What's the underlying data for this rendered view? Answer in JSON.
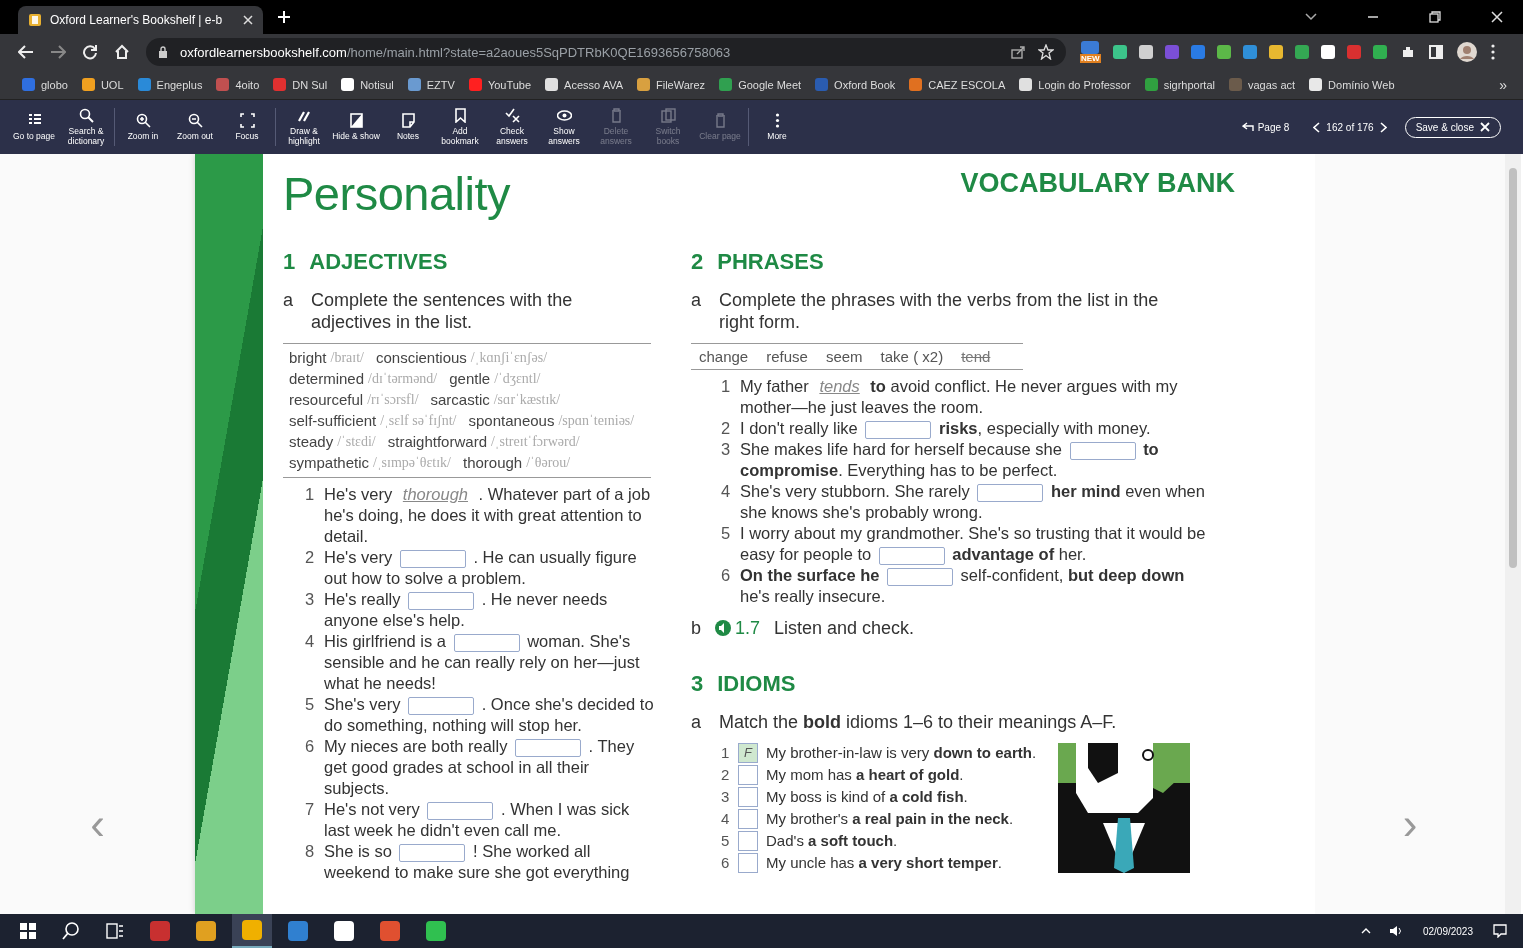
{
  "browser": {
    "tabs": [
      {
        "title": "Oxford Learner's Bookshelf | e-b",
        "selected": true
      }
    ],
    "url": {
      "host": "oxfordlearnersbookshelf.com",
      "path": "/home/main.html?state=a2aoues5SqPDTRbK0QE1693656758063"
    },
    "extensions": [
      {
        "color": "#3b7bd4",
        "badge": "NEW"
      },
      {
        "color": "#3cc48a"
      },
      {
        "color": "#d0d0d0"
      },
      {
        "color": "#7b4fd6"
      },
      {
        "color": "#2a7be4"
      },
      {
        "color": "#5cb848"
      },
      {
        "color": "#2f8fd8"
      },
      {
        "color": "#e8b830"
      },
      {
        "color": "#34a853"
      },
      {
        "color": "#ffffff"
      },
      {
        "color": "#d93030"
      },
      {
        "color": "#30b050"
      }
    ],
    "bookmarks": [
      {
        "label": "globo",
        "color": "#2f6fe0"
      },
      {
        "label": "UOL",
        "color": "#f0a020"
      },
      {
        "label": "Engeplus",
        "color": "#2a8ad8"
      },
      {
        "label": "4oito",
        "color": "#c05050"
      },
      {
        "label": "DN Sul",
        "color": "#e03030"
      },
      {
        "label": "Notisul",
        "color": "#ffffff"
      },
      {
        "label": "EZTV",
        "color": "#6a9ad0"
      },
      {
        "label": "YouTube",
        "color": "#ff2020"
      },
      {
        "label": "Acesso AVA",
        "color": "#e0e0e0"
      },
      {
        "label": "FileWarez",
        "color": "#d8a040"
      },
      {
        "label": "Google Meet",
        "color": "#30a050"
      },
      {
        "label": "Oxford Book",
        "color": "#2a5cb0"
      },
      {
        "label": "CAEZ ESCOLA",
        "color": "#e07020"
      },
      {
        "label": "Login do Professor",
        "color": "#e0e0e0"
      },
      {
        "label": "sigrhportal",
        "color": "#30a040"
      },
      {
        "label": "vagas act",
        "color": "#6b5b4b"
      },
      {
        "label": "Domínio Web",
        "color": "#e8e8e8"
      }
    ],
    "bookmarks_more": "»"
  },
  "toolbar": {
    "tools": [
      {
        "kind": "button",
        "label": "Go to page",
        "disabled": false
      },
      {
        "kind": "button",
        "label": "Search & dictionary",
        "disabled": false
      },
      {
        "kind": "separator"
      },
      {
        "kind": "button",
        "label": "Zoom in",
        "disabled": false
      },
      {
        "kind": "button",
        "label": "Zoom out",
        "disabled": false
      },
      {
        "kind": "button",
        "label": "Focus",
        "disabled": false
      },
      {
        "kind": "separator"
      },
      {
        "kind": "button",
        "label": "Draw & highlight",
        "disabled": false
      },
      {
        "kind": "button",
        "label": "Hide & show",
        "disabled": false
      },
      {
        "kind": "button",
        "label": "Notes",
        "disabled": false
      },
      {
        "kind": "button",
        "label": "Add bookmark",
        "disabled": false
      },
      {
        "kind": "button",
        "label": "Check answers",
        "disabled": false
      },
      {
        "kind": "button",
        "label": "Show answers",
        "disabled": false
      },
      {
        "kind": "button",
        "label": "Delete answers",
        "disabled": true
      },
      {
        "kind": "button",
        "label": "Switch books",
        "disabled": true
      },
      {
        "kind": "button",
        "label": "Clear page",
        "disabled": true
      },
      {
        "kind": "separator"
      },
      {
        "kind": "button",
        "label": "More",
        "disabled": false
      }
    ],
    "page_link": "Page 8",
    "page_count": "162 of 176",
    "save_close": "Save & close"
  },
  "page": {
    "prev_arrow": "‹",
    "next_arrow": "›",
    "title": "Personality",
    "banner": "VOCABULARY BANK",
    "adjectives": {
      "number": "1",
      "heading": "ADJECTIVES",
      "letter": "a",
      "instruction": "Complete the sentences with the adjectives in the list.",
      "words": [
        {
          "word": "bright",
          "phonetic": "/braɪt/"
        },
        {
          "word": "conscientious",
          "phonetic": "/ˌkɑnʃiˈɛnʃəs/"
        },
        {
          "word": "determined",
          "phonetic": "/dɪˈtərmənd/"
        },
        {
          "word": "gentle",
          "phonetic": "/ˈdʒɛntl/"
        },
        {
          "word": "resourceful",
          "phonetic": "/rɪˈsɔrsfl/"
        },
        {
          "word": "sarcastic",
          "phonetic": "/sɑrˈkæstɪk/"
        },
        {
          "word": "self-sufficient",
          "phonetic": "/ˌsɛlf səˈfɪʃnt/"
        },
        {
          "word": "spontaneous",
          "phonetic": "/spɑnˈteɪniəs/"
        },
        {
          "word": "steady",
          "phonetic": "/ˈstɛdi/"
        },
        {
          "word": "straightforward",
          "phonetic": "/ˌstreɪtˈfɔrwərd/"
        },
        {
          "word": "sympathetic",
          "phonetic": "/ˌsɪmpəˈθɛtɪk/"
        },
        {
          "word": "thorough",
          "phonetic": "/ˈθərou/"
        }
      ],
      "items": [
        {
          "number": "1",
          "before": "He's very",
          "gap": {
            "kind": "example",
            "value": "thorough"
          },
          "after": ". Whatever part of a job he's doing, he does it with great attention to detail."
        },
        {
          "number": "2",
          "before": "He's very",
          "gap": {
            "kind": "input"
          },
          "after": ". He can usually figure out how to solve a problem."
        },
        {
          "number": "3",
          "before": "He's really",
          "gap": {
            "kind": "input"
          },
          "after": ". He never needs anyone else's help."
        },
        {
          "number": "4",
          "before": "His girlfriend is a",
          "gap": {
            "kind": "input"
          },
          "after": "woman. She's sensible and he can really rely on her—just what he needs!"
        },
        {
          "number": "5",
          "before": "She's very",
          "gap": {
            "kind": "input"
          },
          "after": ". Once she's decided to do something, nothing will stop her."
        },
        {
          "number": "6",
          "before": "My nieces are both really",
          "gap": {
            "kind": "input"
          },
          "after": ". They get good grades at school in all their subjects."
        },
        {
          "number": "7",
          "before": "He's not very",
          "gap": {
            "kind": "input"
          },
          "after": ". When I was sick last week he didn't even call me."
        },
        {
          "number": "8",
          "before": "She is so",
          "gap": {
            "kind": "input"
          },
          "after": "! She worked all weekend to make sure she got everything"
        }
      ]
    },
    "phrases": {
      "number": "2",
      "heading": "PHRASES",
      "letter": "a",
      "instruction": "Complete the phrases with the verbs from the list in the right form.",
      "words": [
        {
          "word": "change",
          "crossed": false
        },
        {
          "word": "refuse",
          "crossed": false
        },
        {
          "word": "seem",
          "crossed": false
        },
        {
          "word": "take ( x2)",
          "crossed": false
        },
        {
          "word": "tend",
          "crossed": true
        }
      ],
      "items": [
        {
          "number": "1",
          "before": "My father",
          "gap": {
            "kind": "example",
            "value": "tends"
          },
          "after": "**to** avoid conflict. He never argues with my mother—he just leaves the room."
        },
        {
          "number": "2",
          "before": "I don't really like",
          "gap": {
            "kind": "input"
          },
          "after": "**risks**, especially with money."
        },
        {
          "number": "3",
          "before": "She makes life hard for herself because she",
          "gap": {
            "kind": "input"
          },
          "after": "**to compromise**. Everything has to be perfect."
        },
        {
          "number": "4",
          "before": "She's very stubborn. She rarely",
          "gap": {
            "kind": "input"
          },
          "after": "**her mind** even when she knows she's probably wrong."
        },
        {
          "number": "5",
          "before": "I worry about my grandmother. She's so trusting that it would be easy for people to",
          "gap": {
            "kind": "input"
          },
          "after": "**advantage of** her."
        },
        {
          "number": "6",
          "before": "**On the surface he**",
          "gap": {
            "kind": "input"
          },
          "after": "self-confident, **but deep down** he's really insecure."
        }
      ],
      "listen": {
        "letter": "b",
        "track": "1.7",
        "text": "Listen and check."
      }
    },
    "idioms": {
      "number": "3",
      "heading": "IDIOMS",
      "letter": "a",
      "instruction": "Match the **bold** idioms 1–6 to their meanings A–F.",
      "items": [
        {
          "number": "1",
          "answer": {
            "kind": "example",
            "value": "F"
          },
          "text": "My brother-in-law is very **down to earth**."
        },
        {
          "number": "2",
          "answer": {
            "kind": "input"
          },
          "text": "My mom has **a heart of gold**."
        },
        {
          "number": "3",
          "answer": {
            "kind": "input"
          },
          "text": "My boss is kind of **a cold fish**."
        },
        {
          "number": "4",
          "answer": {
            "kind": "input"
          },
          "text": "My brother's **a real pain in the neck**."
        },
        {
          "number": "5",
          "answer": {
            "kind": "input"
          },
          "text": "Dad's **a soft touch**."
        },
        {
          "number": "6",
          "answer": {
            "kind": "input"
          },
          "text": "My uncle has **a very short temper**."
        }
      ]
    }
  },
  "taskbar": {
    "apps": [
      {
        "color": "#c83030",
        "selected": false
      },
      {
        "color": "#e0a020",
        "selected": false
      },
      {
        "color": "#f0b000",
        "selected": true
      },
      {
        "color": "#3080d0",
        "selected": false
      },
      {
        "color": "#ffffff",
        "selected": false
      },
      {
        "color": "#e05030",
        "selected": false
      },
      {
        "color": "#30c050",
        "selected": false
      }
    ],
    "date": "02/09/2023"
  }
}
